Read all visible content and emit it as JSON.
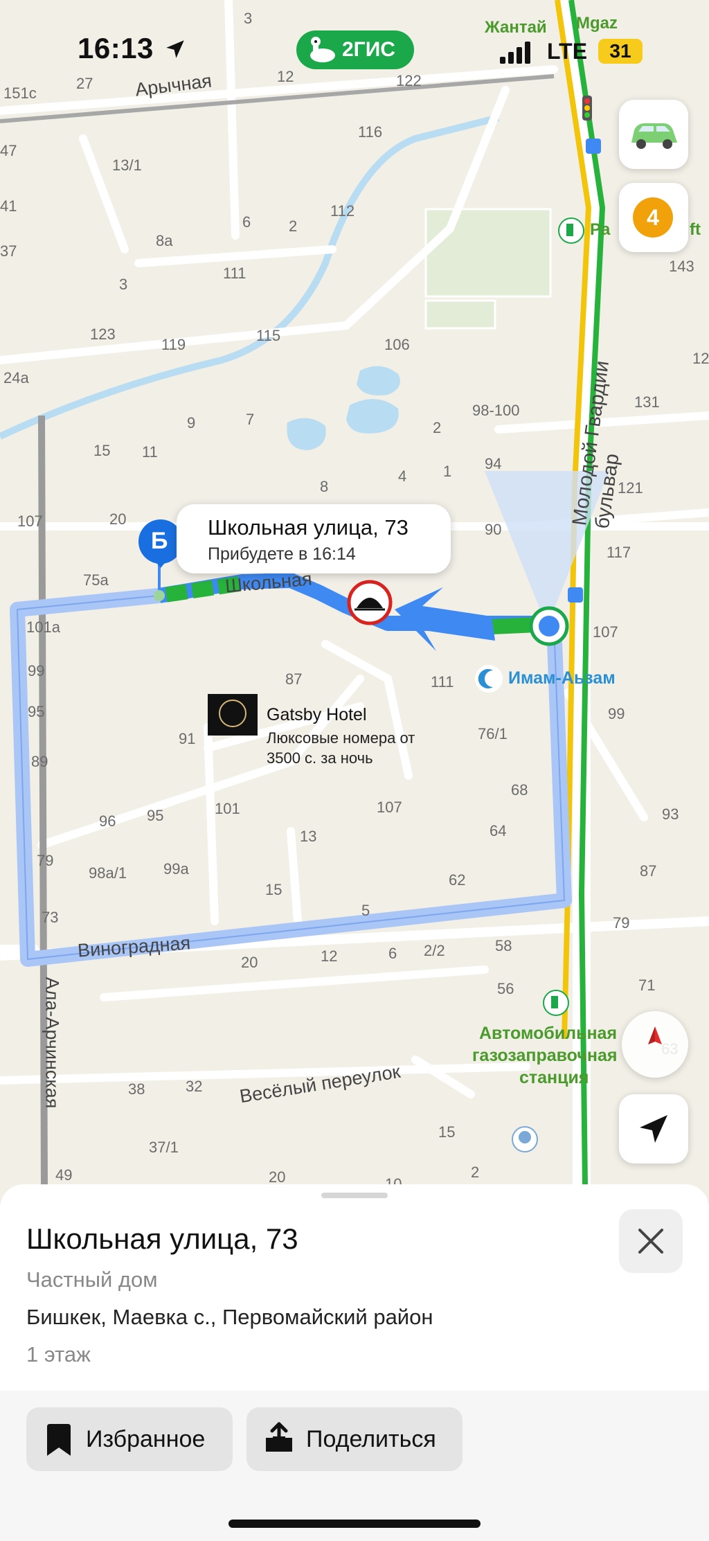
{
  "status_bar": {
    "time": "16:13",
    "app_name": "2ГИС",
    "network": "LTE",
    "battery": "31"
  },
  "map": {
    "streets": {
      "arychnaya": "Арычная",
      "shkolnaya": "Школьная",
      "vinogradnaya": "Виноградная",
      "ala_archinskaya": "Ала-Арчинская",
      "veselyi": "Весёлый переулок",
      "boulevard": "Молодой Гвардии бульвар"
    },
    "house_numbers": [
      "3",
      "27",
      "151c",
      "12",
      "122",
      "116",
      "47",
      "13/1",
      "41",
      "112",
      "6",
      "2",
      "8a",
      "37",
      "111",
      "3",
      "143",
      "123",
      "119",
      "115",
      "106",
      "24a",
      "12,",
      "131",
      "98-100",
      "9",
      "7",
      "2",
      "15",
      "11",
      "94",
      "8",
      "4",
      "1",
      "121",
      "107",
      "20",
      "90",
      "75a",
      "117",
      "62",
      "101a",
      "87",
      "111",
      "99",
      "107",
      "95",
      "91",
      "76/1",
      "99",
      "89",
      "68",
      "96",
      "95",
      "101",
      "107",
      "64",
      "93",
      "13",
      "79",
      "98a/1",
      "99a",
      "62",
      "87",
      "15",
      "5",
      "73",
      "79",
      "12",
      "6",
      "2/2",
      "58",
      "20",
      "56",
      "71",
      "38",
      "32",
      "15",
      "37/1",
      "2",
      "49",
      "20",
      "10",
      "63"
    ],
    "pois": {
      "hotel_name": "Gatsby Hotel",
      "hotel_desc_1": "Люксовые номера от",
      "hotel_desc_2": "3500 с. за ночь",
      "mosque": "Имам-Аьзам",
      "gas_1": "Автомобильная",
      "gas_2": "газозаправочная",
      "gas_3": "станция",
      "zhantai": "Жантай",
      "mgaz": "Mgaz",
      "pa": "Pa",
      "ft": "ft"
    },
    "destination_marker": "Б",
    "callout": {
      "title": "Школьная улица, 73",
      "eta": "Прибудете в 16:14"
    },
    "traffic_score": "4"
  },
  "sheet": {
    "title": "Школьная улица, 73",
    "subtitle": "Частный дом",
    "address": "Бишкек, Маевка с., Первомайский район",
    "floors": "1 этаж",
    "actions": {
      "favorite": "Избранное",
      "share": "Поделиться"
    }
  },
  "colors": {
    "route": "#3f8af2",
    "route_alt": "#a9c6f7",
    "traffic_green": "#27b23b",
    "traffic_yellow": "#f2c40a",
    "badge": "#f1a10a",
    "brand_green": "#1aa84a"
  }
}
